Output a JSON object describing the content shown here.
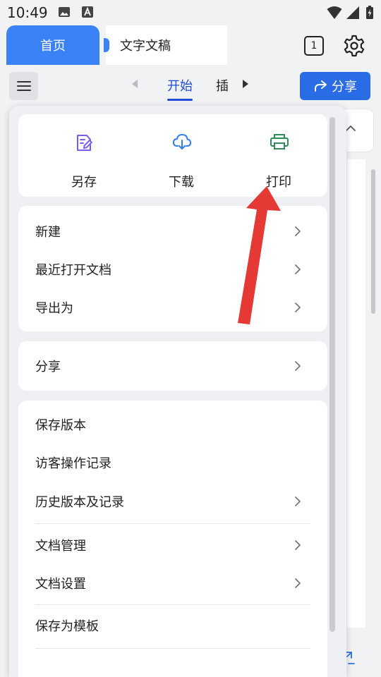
{
  "status_bar": {
    "time": "10:49"
  },
  "tabs": {
    "home": "首页",
    "document": "文字文稿",
    "tab_count": "1"
  },
  "toolbar": {
    "active_tab": "开始",
    "next_tab": "插入",
    "share_label": "分享"
  },
  "quick_actions": [
    {
      "label": "另存",
      "icon": "save-as-icon",
      "color": "#7b5cf0"
    },
    {
      "label": "下载",
      "icon": "download-icon",
      "color": "#2f7fe6"
    },
    {
      "label": "打印",
      "icon": "print-icon",
      "color": "#2e8b57"
    }
  ],
  "menu_group_1": [
    {
      "label": "新建"
    },
    {
      "label": "最近打开文档"
    },
    {
      "label": "导出为"
    }
  ],
  "menu_group_2": [
    {
      "label": "分享"
    }
  ],
  "menu_group_3": [
    {
      "label": "保存版本"
    },
    {
      "label": "访客操作记录"
    },
    {
      "label": "历史版本及记录"
    },
    {
      "label": "文档管理"
    },
    {
      "label": "文档设置"
    },
    {
      "label": "保存为模板"
    }
  ],
  "colors": {
    "accent": "#2a6ce6",
    "tab_blue": "#3b82f6",
    "annotation_arrow": "#e53935"
  }
}
